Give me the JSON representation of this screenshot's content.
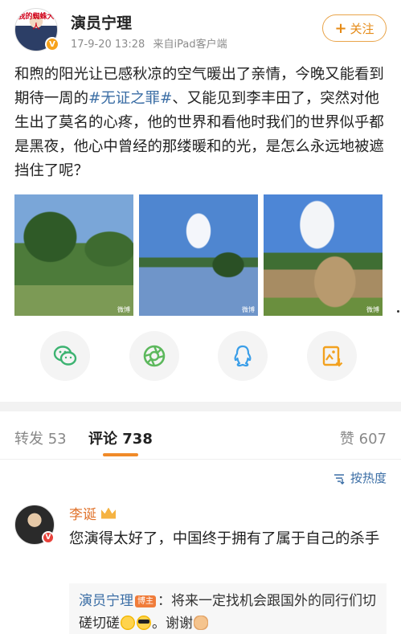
{
  "header": {
    "avatar_tag": "我的蜘蛛大人",
    "username": "演员宁理",
    "timestamp": "17-9-20 13:28",
    "source": "来自iPad客户端",
    "follow_label": "关注"
  },
  "post": {
    "text_before": "和煦的阳光让已感秋凉的空气暖出了亲情，今晚又能看到期待一周的",
    "hashtag": "#无证之罪#",
    "text_after": "、又能见到李丰田了，突然对他生出了莫名的心疼，他的世界和看他时我们的世界似乎都是黑夜，他心中曾经的那缕暖和的光，是怎么永远地被遮挡住了呢？",
    "photos": [
      {
        "name": "photo-garden",
        "watermark": "微博"
      },
      {
        "name": "photo-lake",
        "watermark": "微博"
      },
      {
        "name": "photo-playground",
        "watermark": "微博"
      }
    ]
  },
  "share": {
    "items": [
      "wechat-icon",
      "moments-icon",
      "qq-icon",
      "save-image-icon"
    ]
  },
  "tabs": {
    "repost_label": "转发 53",
    "comments_label": "评论 738",
    "likes_label": "赞 607"
  },
  "sort": {
    "label": "按热度"
  },
  "comment": {
    "author": "李诞",
    "text": "您演得太好了，中国终于拥有了属于自己的杀手",
    "reply": {
      "author": "演员宁理",
      "host_badge": "博主",
      "text_a": "：将来一定找机会跟国外的同行们切磋切磋",
      "text_b": "。谢谢"
    }
  },
  "colors": {
    "accent_orange": "#f08a28",
    "link_blue": "#3b6ea5",
    "name_orange": "#e0732c"
  }
}
